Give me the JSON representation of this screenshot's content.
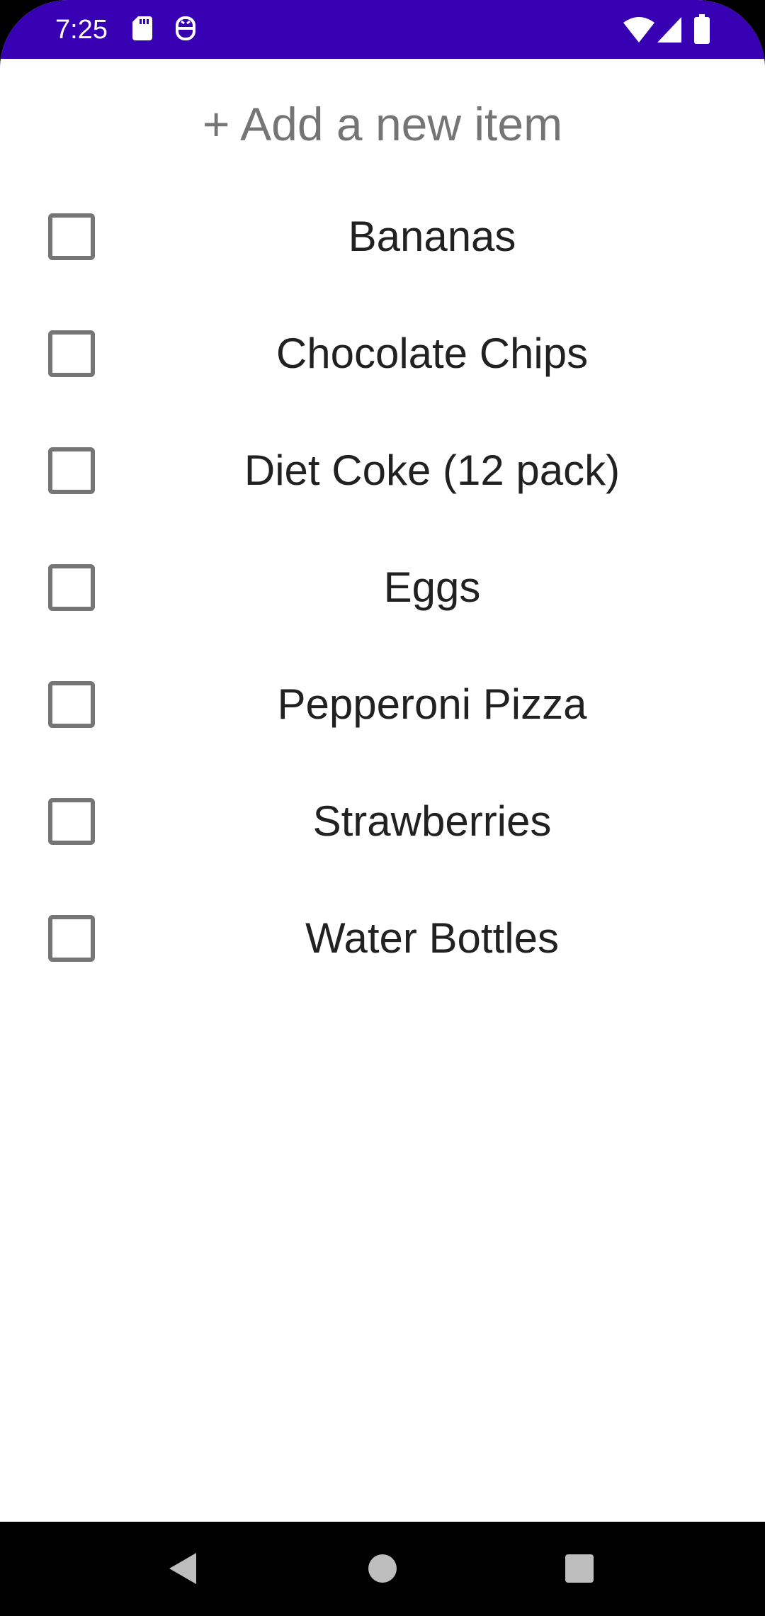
{
  "status_bar": {
    "time": "7:25",
    "icons": [
      "sd-card-icon",
      "notification-app-icon",
      "wifi-icon",
      "cellular-signal-icon",
      "battery-icon"
    ],
    "background_color": "#3700B3"
  },
  "add_item": {
    "label": "+ Add a new item"
  },
  "items": [
    {
      "label": "Bananas",
      "checked": false
    },
    {
      "label": "Chocolate Chips",
      "checked": false
    },
    {
      "label": "Diet Coke (12 pack)",
      "checked": false
    },
    {
      "label": "Eggs",
      "checked": false
    },
    {
      "label": "Pepperoni Pizza",
      "checked": false
    },
    {
      "label": "Strawberries",
      "checked": false
    },
    {
      "label": "Water Bottles",
      "checked": false
    }
  ],
  "nav_bar": {
    "buttons": [
      "back-icon",
      "home-icon",
      "recents-icon"
    ]
  }
}
